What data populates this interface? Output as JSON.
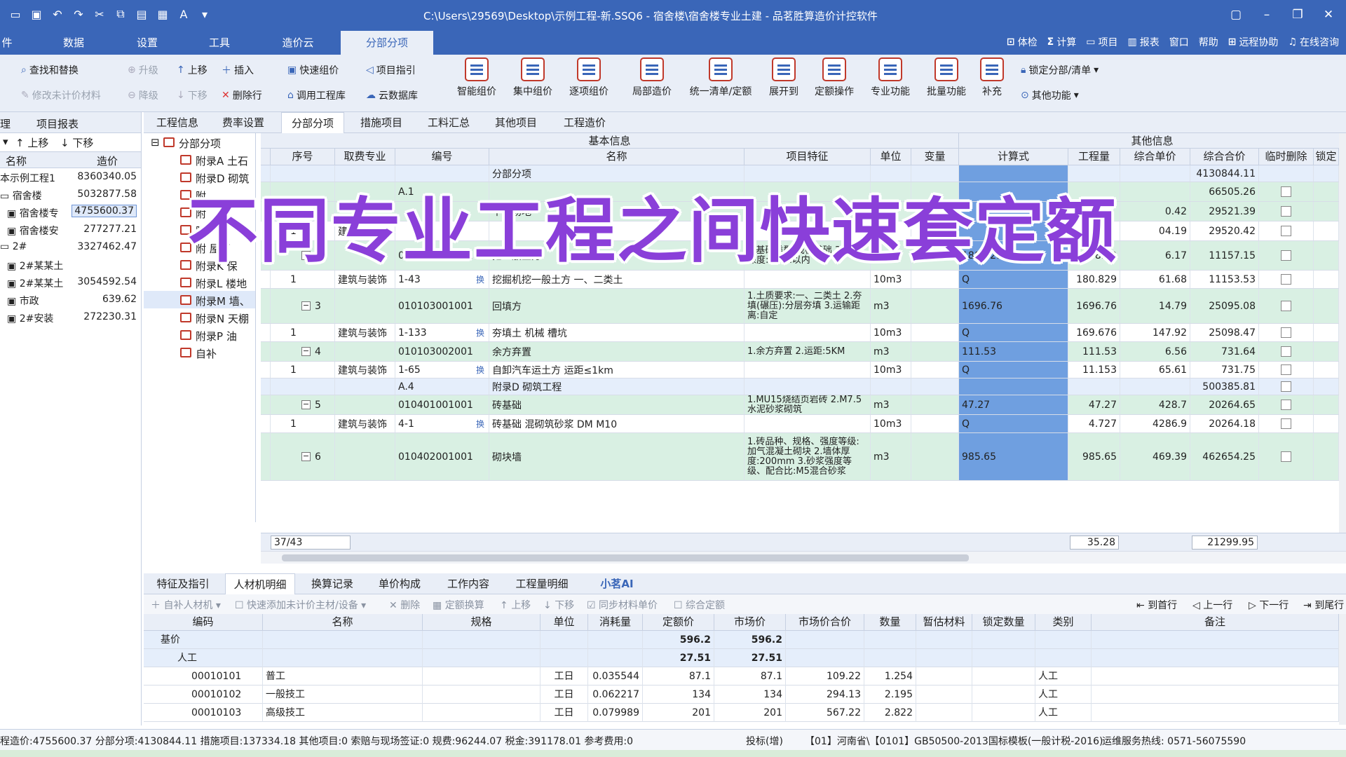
{
  "window": {
    "title": "C:\\Users\\29569\\Desktop\\示例工程-新.SSQ6 - 宿舍楼\\宿舍楼专业土建 - 品茗胜算造价计控软件"
  },
  "menu": {
    "tabs": [
      "件",
      "数据",
      "设置",
      "工具",
      "造价云",
      "分部分项"
    ],
    "right": [
      "体检",
      "计算",
      "项目",
      "报表",
      "窗口",
      "帮助",
      "远程协助",
      "在线咨询"
    ]
  },
  "ribbon": {
    "find_replace": "查找和替换",
    "edit_material": "修改未计价材料",
    "upgrade": "升级",
    "downgrade": "降级",
    "move_up": "上移",
    "move_down": "下移",
    "insert": "插入",
    "delete_row": "删除行",
    "quick_group": "快速组价",
    "project_guide": "项目指引",
    "call_lib": "调用工程库",
    "cloud_db": "云数据库",
    "big_buttons": [
      "智能组价",
      "集中组价",
      "逐项组价",
      "局部造价",
      "统一清单/定额",
      "展开到",
      "定额操作",
      "专业功能",
      "批量功能",
      "补充"
    ],
    "lock": "锁定分部/清单",
    "other": "其他功能"
  },
  "left_pane": {
    "tabs": [
      "理",
      "项目报表"
    ],
    "up": "上移",
    "down": "下移",
    "col_name": "名称",
    "col_cost": "造价",
    "rows": [
      {
        "name": "本示例工程1",
        "value": "8360340.05"
      },
      {
        "name": "宿舍楼",
        "value": "5032877.58"
      },
      {
        "name": "宿舍楼专",
        "value": "4755600.37"
      },
      {
        "name": "宿舍楼安",
        "value": "277277.21"
      },
      {
        "name": "2#",
        "value": "3327462.47"
      },
      {
        "name": "2#某某土",
        "value": ""
      },
      {
        "name": "2#某某土",
        "value": "3054592.54"
      },
      {
        "name": "市政",
        "value": "639.62"
      },
      {
        "name": "2#安装",
        "value": "272230.31"
      }
    ]
  },
  "tree": {
    "root": "分部分项",
    "items": [
      "附录A 土石",
      "附录D 砌筑",
      "附",
      "附",
      "附",
      "附 屋面",
      "附录K 保",
      "附录L 楼地",
      "附录M 墙、",
      "附录N 天棚",
      "附录P 油",
      "自补"
    ]
  },
  "main_tabs": [
    "工程信息",
    "费率设置",
    "分部分项",
    "措施项目",
    "工料汇总",
    "其他项目",
    "工程造价"
  ],
  "grid": {
    "group_basic": "基本信息",
    "group_other": "其他信息",
    "headers": [
      "序号",
      "取费专业",
      "编号",
      "名称",
      "项目特征",
      "单位",
      "变量",
      "计算式",
      "工程量",
      "综合单价",
      "综合合价",
      "临时删除",
      "锁定"
    ],
    "rows": [
      {
        "type": "blue",
        "seq": "",
        "spec": "",
        "code": "",
        "name": "分部分项",
        "feat": "",
        "unit": "",
        "calc": "",
        "qty": "",
        "price": "",
        "total": "4130844.11",
        "cb": false
      },
      {
        "type": "green",
        "seq": "",
        "spec": "",
        "code": "A.1",
        "name": "",
        "feat": "",
        "unit": "",
        "calc": "",
        "qty": "",
        "price": "",
        "total": "66505.26",
        "cb": true
      },
      {
        "type": "green",
        "seq": "",
        "spec": "",
        "code": "",
        "name": "平整场地",
        "feat": "",
        "unit": "",
        "calc": "",
        "qty": "",
        "price": "0.42",
        "total": "29521.39",
        "cb": true
      },
      {
        "type": "white",
        "seq": "1",
        "spec": "建筑与装饰",
        "code": "",
        "name": "",
        "feat": "",
        "unit": "",
        "calc": "",
        "qty": "",
        "price": "04.19",
        "total": "29520.42",
        "cb": true
      },
      {
        "type": "green",
        "seq": "2",
        "spec": "",
        "code": "010101002001",
        "name": "挖一般土方",
        "feat": "2.基础类型:筏板基础\n3.挖土深度:3.5m以内",
        "unit": "m3",
        "calc": "1808.29",
        "qty": "1808.29",
        "price": "6.17",
        "total": "11157.15",
        "cb": true
      },
      {
        "type": "white",
        "seq": "1",
        "spec": "建筑与装饰",
        "code": "1-43",
        "name": "挖掘机挖一般土方 一、二类土",
        "feat": "",
        "unit": "10m3",
        "calc": "Q",
        "qty": "180.829",
        "price": "61.68",
        "total": "11153.53",
        "cb": true
      },
      {
        "type": "green",
        "seq": "3",
        "spec": "",
        "code": "010103001001",
        "name": "回填方",
        "feat": "1.土质要求:一、二类土\n2.夯填(碾压):分层夯填\n3.运输距离:自定",
        "unit": "m3",
        "calc": "1696.76",
        "qty": "1696.76",
        "price": "14.79",
        "total": "25095.08",
        "cb": true
      },
      {
        "type": "white",
        "seq": "1",
        "spec": "建筑与装饰",
        "code": "1-133",
        "name": "夯填土 机械 槽坑",
        "feat": "",
        "unit": "10m3",
        "calc": "Q",
        "qty": "169.676",
        "price": "147.92",
        "total": "25098.47",
        "cb": true
      },
      {
        "type": "green",
        "seq": "4",
        "spec": "",
        "code": "010103002001",
        "name": "余方弃置",
        "feat": "1.余方弃置\n2.运距:5KM",
        "unit": "m3",
        "calc": "111.53",
        "qty": "111.53",
        "price": "6.56",
        "total": "731.64",
        "cb": true
      },
      {
        "type": "white",
        "seq": "1",
        "spec": "建筑与装饰",
        "code": "1-65",
        "name": "自卸汽车运土方 运距≤1km",
        "feat": "",
        "unit": "10m3",
        "calc": "Q",
        "qty": "11.153",
        "price": "65.61",
        "total": "731.75",
        "cb": true
      },
      {
        "type": "blue",
        "seq": "",
        "spec": "",
        "code": "A.4",
        "name": "附录D 砌筑工程",
        "feat": "",
        "unit": "",
        "calc": "",
        "qty": "",
        "price": "",
        "total": "500385.81",
        "cb": true
      },
      {
        "type": "green",
        "seq": "5",
        "spec": "",
        "code": "010401001001",
        "name": "砖基础",
        "feat": "1.MU15烧结页岩砖\n2.M7.5水泥砂浆砌筑",
        "unit": "m3",
        "calc": "47.27",
        "qty": "47.27",
        "price": "428.7",
        "total": "20264.65",
        "cb": true
      },
      {
        "type": "white",
        "seq": "1",
        "spec": "建筑与装饰",
        "code": "4-1",
        "name": "砖基础 混砌筑砂浆 DM M10",
        "feat": "",
        "unit": "10m3",
        "calc": "Q",
        "qty": "4.727",
        "price": "4286.9",
        "total": "20264.18",
        "cb": true
      },
      {
        "type": "green",
        "seq": "6",
        "spec": "",
        "code": "010402001001",
        "name": "砌块墙",
        "feat": "1.砖品种、规格、强度等级:加气混凝土砌块\n2.墙体厚度:200mm\n3.砂浆强度等级、配合比:M5混合砂浆",
        "unit": "m3",
        "calc": "985.65",
        "qty": "985.65",
        "price": "469.39",
        "total": "462654.25",
        "cb": true
      }
    ],
    "footer": {
      "position": "37/43",
      "qty": "35.28",
      "total": "21299.95"
    }
  },
  "bottom": {
    "tabs": [
      "特征及指引",
      "人材机明细",
      "换算记录",
      "单价构成",
      "工作内容",
      "工程量明细",
      "小茗AI"
    ],
    "tools": [
      "自补人材机",
      "快速添加未计价主材/设备",
      "删除",
      "定额换算",
      "上移",
      "下移",
      "同步材料单价",
      "综合定额"
    ],
    "nav": [
      "到首行",
      "上一行",
      "下一行",
      "到尾行"
    ],
    "headers": [
      "编码",
      "名称",
      "规格",
      "单位",
      "消耗量",
      "定额价",
      "市场价",
      "市场价合价",
      "数量",
      "暂估材料",
      "锁定数量",
      "类别",
      "备注"
    ],
    "rows": [
      {
        "code": "基价",
        "name": "",
        "spec": "",
        "unit": "",
        "cons": "",
        "quota": "596.2",
        "market": "596.2",
        "mtotal": "",
        "qty": "",
        "cat": ""
      },
      {
        "code": "人工",
        "name": "",
        "spec": "",
        "unit": "",
        "cons": "",
        "quota": "27.51",
        "market": "27.51",
        "mtotal": "",
        "qty": "",
        "cat": ""
      },
      {
        "code": "00010101",
        "name": "普工",
        "spec": "",
        "unit": "工日",
        "cons": "0.035544",
        "quota": "87.1",
        "market": "87.1",
        "mtotal": "109.22",
        "qty": "1.254",
        "cat": "人工"
      },
      {
        "code": "00010102",
        "name": "一般技工",
        "spec": "",
        "unit": "工日",
        "cons": "0.062217",
        "quota": "134",
        "market": "134",
        "mtotal": "294.13",
        "qty": "2.195",
        "cat": "人工"
      },
      {
        "code": "00010103",
        "name": "高级技工",
        "spec": "",
        "unit": "工日",
        "cons": "0.079989",
        "quota": "201",
        "market": "201",
        "mtotal": "567.22",
        "qty": "2.822",
        "cat": "人工"
      }
    ]
  },
  "status": {
    "left": "程造价:4755600.37 分部分项:4130844.11 措施项目:137334.18 其他项目:0 索赔与现场签证:0 规费:96244.07 税金:391178.01 参考费用:0",
    "mode": "投标(增)",
    "template": "【01】河南省\\【0101】GB50500-2013国标模板(一般计税-2016)",
    "hotline": "运维服务热线: 0571-56075590"
  },
  "overlay": {
    "caption": "不同专业工程之间快速套定额"
  }
}
